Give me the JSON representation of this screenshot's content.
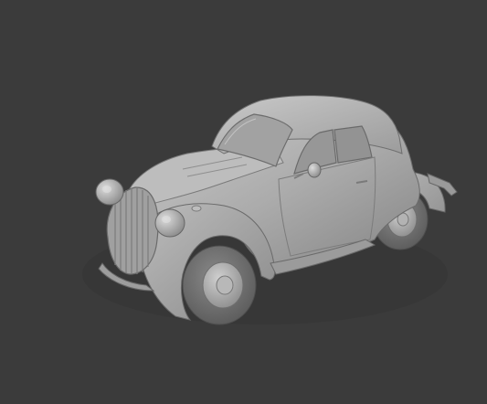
{
  "viewport": {
    "background_color": "#3b3b3b",
    "subject": "car-model",
    "shading": "solid-gray",
    "colors": {
      "body": "#a9a9a9",
      "body_light": "#c4c4c4",
      "body_dark": "#7a7a7a",
      "tire": "#6e6e6e",
      "window": "#8f8f8f"
    }
  }
}
